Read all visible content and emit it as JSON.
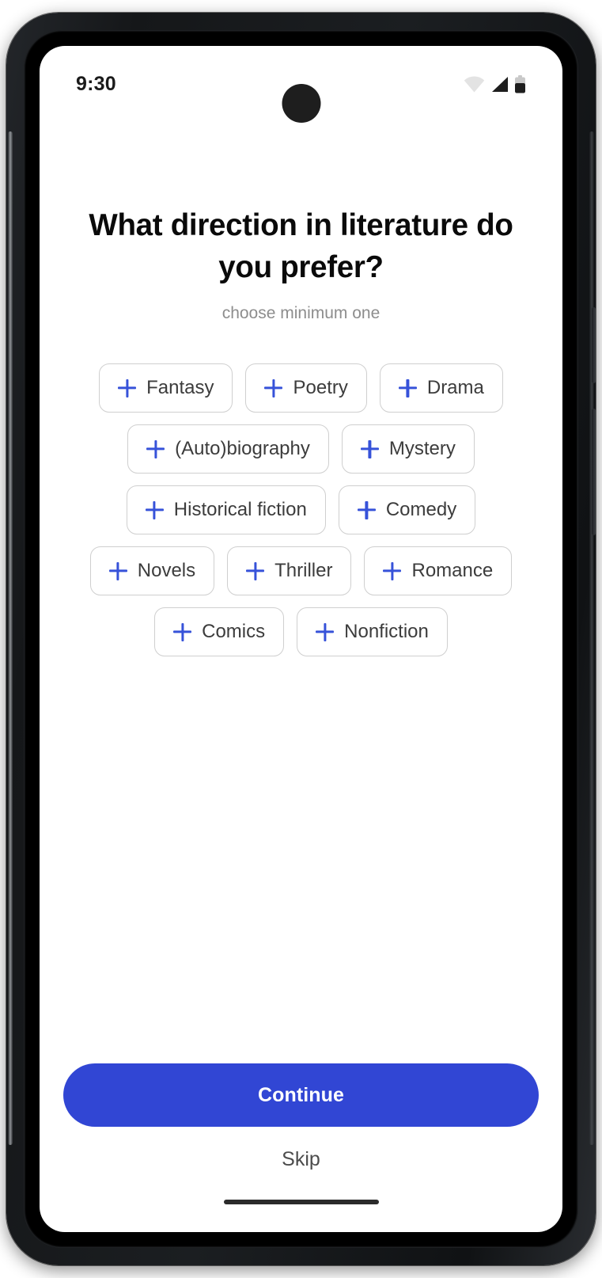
{
  "status_bar": {
    "time": "9:30",
    "icons": [
      {
        "name": "wifi-icon",
        "label": "wifi"
      },
      {
        "name": "cellular-signal-icon",
        "label": "signal"
      },
      {
        "name": "battery-icon",
        "label": "battery"
      }
    ]
  },
  "screen": {
    "title": "What direction in literature do you prefer?",
    "subtitle": "choose minimum one"
  },
  "genre_rows": [
    [
      {
        "label": "Fantasy"
      },
      {
        "label": "Poetry"
      },
      {
        "label": "Drama"
      }
    ],
    [
      {
        "label": "(Auto)biography"
      },
      {
        "label": "Mystery"
      }
    ],
    [
      {
        "label": "Historical fiction"
      },
      {
        "label": "Comedy"
      }
    ],
    [
      {
        "label": "Novels"
      },
      {
        "label": "Thriller"
      },
      {
        "label": "Romance"
      }
    ],
    [
      {
        "label": "Comics"
      },
      {
        "label": "Nonfiction"
      }
    ]
  ],
  "footer": {
    "continue_label": "Continue",
    "skip_label": "Skip"
  },
  "colors": {
    "accent": "#3146d4",
    "plus_icon": "#3652d9",
    "chip_border": "#cfcfcf",
    "chip_text": "#3c3c3c",
    "title_text": "#0a0a0a",
    "subtitle_text": "#8d8d8d",
    "screen_bg": "#ffffff",
    "frame": "#151719"
  }
}
